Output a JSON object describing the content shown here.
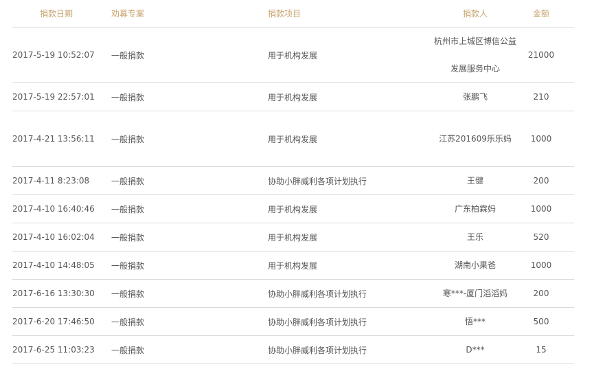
{
  "headers": {
    "date": "捐款日期",
    "campaign": "劝募专案",
    "project": "捐款项目",
    "donor": "捐款人",
    "amount": "金额"
  },
  "rows": [
    {
      "date": "2017-5-19 10:52:07",
      "campaign": "一般捐款",
      "project": "用于机构发展",
      "donor": "杭州市上城区博信公益发展服务中心",
      "amount": "21000"
    },
    {
      "date": "2017-5-19 22:57:01",
      "campaign": "一般捐款",
      "project": "用于机构发展",
      "donor": "张鹏飞",
      "amount": "210"
    },
    {
      "date": "2017-4-21 13:56:11",
      "campaign": "一般捐款",
      "project": "用于机构发展",
      "donor": "江苏201609乐乐妈",
      "amount": "1000"
    },
    {
      "date": "2017-4-11 8:23:08",
      "campaign": "一般捐款",
      "project": "协助小胖威利各项计划执行",
      "donor": "王健",
      "amount": "200"
    },
    {
      "date": "2017-4-10 16:40:46",
      "campaign": "一般捐款",
      "project": "用于机构发展",
      "donor": "广东柏霖妈",
      "amount": "1000"
    },
    {
      "date": "2017-4-10 16:02:04",
      "campaign": "一般捐款",
      "project": "用于机构发展",
      "donor": "王乐",
      "amount": "520"
    },
    {
      "date": "2017-4-10 14:48:05",
      "campaign": "一般捐款",
      "project": "用于机构发展",
      "donor": "湖南小果爸",
      "amount": "1000"
    },
    {
      "date": "2017-6-16 13:30:30",
      "campaign": "一般捐款",
      "project": "协助小胖威利各项计划执行",
      "donor": "寒***-厦门滔滔妈",
      "amount": "200"
    },
    {
      "date": "2017-6-20 17:46:50",
      "campaign": "一般捐款",
      "project": "协助小胖威利各项计划执行",
      "donor": "悟***",
      "amount": "500"
    },
    {
      "date": "2017-6-25 11:03:23",
      "campaign": "一般捐款",
      "project": "协助小胖威利各项计划执行",
      "donor": "D***",
      "amount": "15"
    }
  ]
}
